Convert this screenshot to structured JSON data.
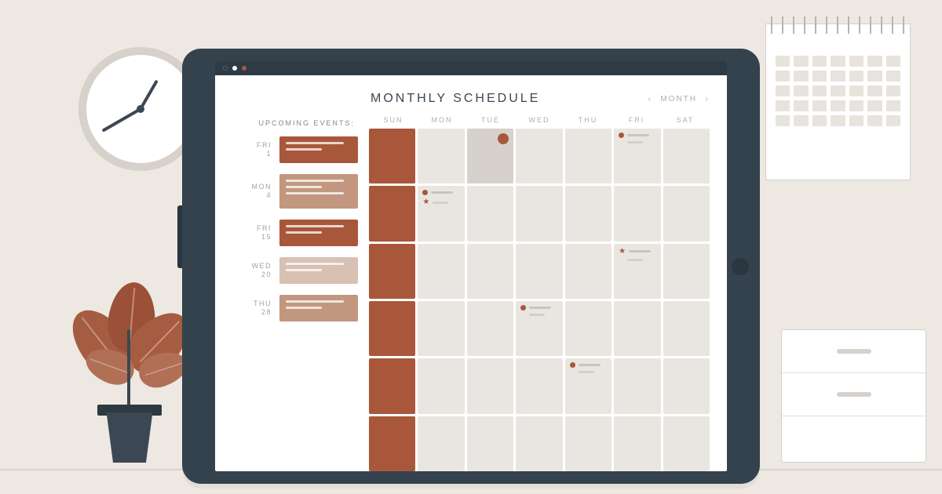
{
  "header": {
    "title": "MONTHLY SCHEDULE",
    "view_label": "MONTH"
  },
  "upcoming": {
    "title": "UPCOMING EVENTS:",
    "events": [
      {
        "dow": "FRI",
        "day": "1",
        "color": "#a8573b"
      },
      {
        "dow": "MON",
        "day": "4",
        "color": "#c2977f"
      },
      {
        "dow": "FRI",
        "day": "15",
        "color": "#a8573b"
      },
      {
        "dow": "WED",
        "day": "20",
        "color": "#d8c1b3"
      },
      {
        "dow": "THU",
        "day": "28",
        "color": "#c2977f"
      }
    ]
  },
  "days": [
    "SUN",
    "MON",
    "TUE",
    "WED",
    "THU",
    "FRI",
    "SAT"
  ],
  "colors": {
    "accent": "#a8573b",
    "tablet": "#34424e",
    "bg": "#ede8e2"
  },
  "grid": {
    "rows": 6,
    "cols": 7,
    "sunday_column_highlight": true,
    "cells_with_markers": [
      {
        "row": 0,
        "col": 2,
        "type": "tue-highlight"
      },
      {
        "row": 0,
        "col": 5,
        "type": "dot-lines"
      },
      {
        "row": 1,
        "col": 1,
        "type": "dot-star-lines"
      },
      {
        "row": 2,
        "col": 5,
        "type": "star-lines"
      },
      {
        "row": 3,
        "col": 3,
        "type": "dot-lines"
      },
      {
        "row": 4,
        "col": 4,
        "type": "dot-lines"
      }
    ]
  }
}
